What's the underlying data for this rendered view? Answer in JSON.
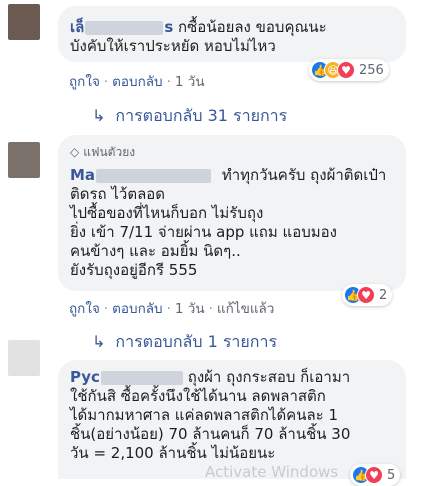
{
  "comments": [
    {
      "name_prefix": "เล็",
      "name_suffix": "s",
      "lines": [
        "กซื้อน้อยลง ขอบคุณนะ",
        "บังคับให้เราประหยัด หอบไม่ไหว"
      ],
      "like": "ถูกใจ",
      "reply": "ตอบกลับ",
      "time": "1 วัน",
      "reaction_count": "256",
      "reaction_icons": [
        "like-icon",
        "haha-icon",
        "love-icon"
      ]
    },
    {
      "replies_link": "การตอบกลับ 31 รายการ"
    },
    {
      "badge": "แฟนตัวยง",
      "name_prefix": "Ma",
      "first_line": "ทำทุกวันครับ ถุงผ้าติดเป๋า",
      "lines": [
        "ติดรถ ไว้ตลอด",
        "ไปซื้อของที่ไหนก็บอก ไม่รับถุง",
        "ยิ่ง เข้า 7/11 จ่ายผ่าน app แถม แอบมอง",
        "คนข้างๆ และ อมยิ้ม นิดๆ..",
        "ยังรับถุงอยู่อีกรี 555"
      ],
      "like": "ถูกใจ",
      "reply": "ตอบกลับ",
      "time": "1 วัน",
      "edited": "แก้ไขแล้ว",
      "reaction_count": "2",
      "reaction_icons": [
        "like-icon",
        "love-icon"
      ]
    },
    {
      "replies_link": "การตอบกลับ 1 รายการ"
    },
    {
      "name_prefix": "Pyc",
      "first_line": "ถุงผ้า ถุงกระสอบ ก็เอามา",
      "lines": [
        "ใช้กันสิ ซื้อครั้งนึงใช้ได้นาน ลดพลาสติก",
        "ได้มากมหาศาล แค่ลดพลาสติกได้คนละ 1",
        "ชิ้น(อย่างน้อย) 70 ล้านคนก็ 70 ล้านชิ้น 30",
        "วัน = 2,100 ล้านชิ้น ไม่น้อยนะ"
      ],
      "reaction_count": "5"
    }
  ],
  "watermark": "Activate Windows",
  "colors": {
    "link": "#385898",
    "bubble": "#f2f3f5",
    "like": "#1877f2",
    "love": "#f33e58",
    "haha": "#f7b125"
  }
}
